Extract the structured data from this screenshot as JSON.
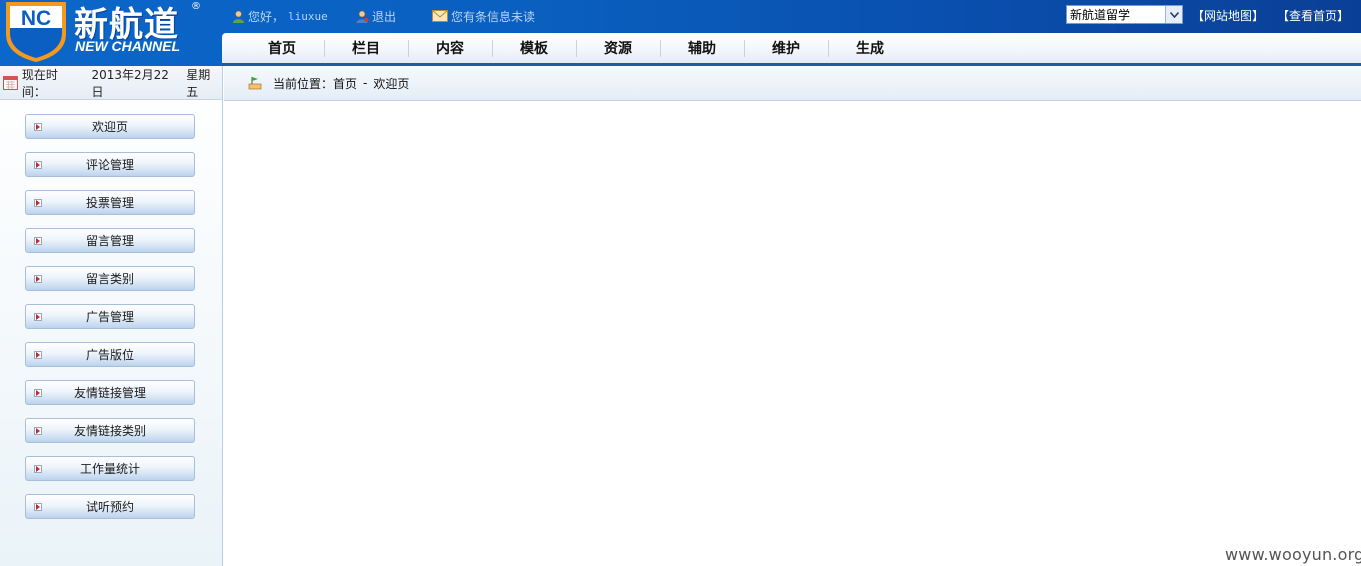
{
  "header": {
    "logo_cn": "新航道",
    "logo_en": "NEW CHANNEL",
    "logo_mark": "NC",
    "greeting": "您好，",
    "username": "liuxue",
    "logout_label": "退出",
    "message_label": "您有条信息未读",
    "site_select": "新航道留学",
    "sitemap_link": "【网站地图】",
    "homepage_link": "【查看首页】"
  },
  "nav": {
    "tabs": [
      {
        "label": "首页"
      },
      {
        "label": "栏目"
      },
      {
        "label": "内容"
      },
      {
        "label": "模板"
      },
      {
        "label": "资源"
      },
      {
        "label": "辅助"
      },
      {
        "label": "维护"
      },
      {
        "label": "生成"
      }
    ]
  },
  "sidebar": {
    "time_label": "现在时间：",
    "date": "2013年2月22日",
    "weekday": "星期五",
    "items": [
      {
        "label": "欢迎页"
      },
      {
        "label": "评论管理"
      },
      {
        "label": "投票管理"
      },
      {
        "label": "留言管理"
      },
      {
        "label": "留言类别"
      },
      {
        "label": "广告管理"
      },
      {
        "label": "广告版位"
      },
      {
        "label": "友情链接管理"
      },
      {
        "label": "友情链接类别"
      },
      {
        "label": "工作量统计"
      },
      {
        "label": "试听预约"
      }
    ]
  },
  "breadcrumb": {
    "prefix": "当前位置：",
    "home": "首页",
    "separator": "-",
    "current": "欢迎页"
  },
  "watermark": "www.wooyun.org",
  "colors": {
    "header_blue": "#0a5fbf",
    "nav_underline": "#1c5ba8",
    "logo_orange": "#f39a1d"
  }
}
